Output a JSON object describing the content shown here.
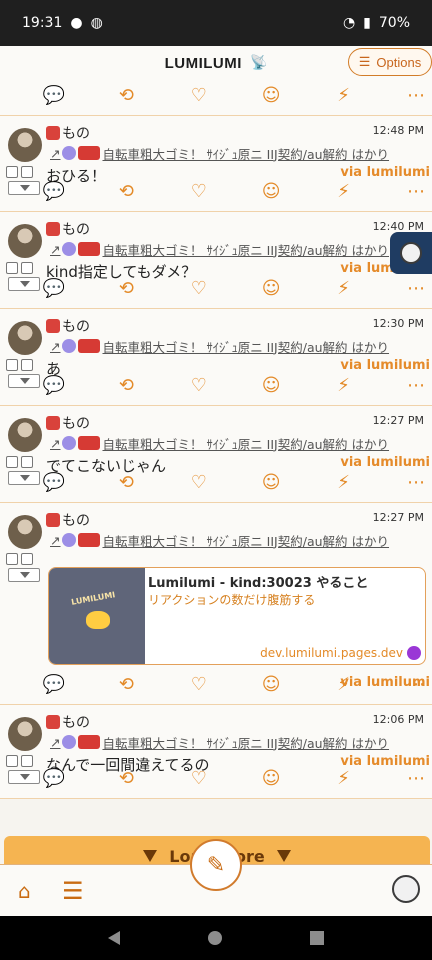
{
  "statusbar": {
    "time": "19:31",
    "battery": "70%"
  },
  "header": {
    "brand": "LUMILUMI",
    "options_label": "Options"
  },
  "timeline": {
    "top_fragment": "...",
    "posts": [
      {
        "name": "もの",
        "time": "12:48 PM",
        "reply_text": "自転車粗大ゴミ！ ｻｲｼﾞｭ原ニ IIJ契約/au解約 はかり",
        "content": "おひる！",
        "via": "via lumilumi"
      },
      {
        "name": "もの",
        "time": "12:40 PM",
        "reply_text": "自転車粗大ゴミ！ ｻｲｼﾞｭ原ニ IIJ契約/au解約 はかり",
        "content": "kind指定してもダメ？",
        "via": "via lumilumi"
      },
      {
        "name": "もの",
        "time": "12:30 PM",
        "reply_text": "自転車粗大ゴミ！ ｻｲｼﾞｭ原ニ IIJ契約/au解約 はかり",
        "content": "あ",
        "via": "via lumilumi"
      },
      {
        "name": "もの",
        "time": "12:27 PM",
        "reply_text": "自転車粗大ゴミ！ ｻｲｼﾞｭ原ニ IIJ契約/au解約 はかり",
        "content": "でてこないじゃん",
        "via": "via lumilumi"
      },
      {
        "name": "もの",
        "time": "12:27 PM",
        "reply_text": "自転車粗大ゴミ！ ｻｲｼﾞｭ原ニ IIJ契約/au解約 はかり",
        "card": {
          "title": "Lumilumi - kind:30023 やること",
          "desc": "リアクションの数だけ腹筋する",
          "domain": "dev.lumilumi.pages.dev",
          "thumb_text": "LUMILUMI"
        },
        "via": "via lumilumi"
      },
      {
        "name": "もの",
        "time": "12:06 PM",
        "reply_text": "自転車粗大ゴミ！ ｻｲｼﾞｭ原ニ IIJ契約/au解約 はかり",
        "content": "なんで一回間違えてるの",
        "via": "via lumilumi"
      }
    ]
  },
  "loadmore": {
    "label": "Load more"
  },
  "icons": {
    "relay": "radio-tower-icon",
    "options": "sliders-icon",
    "reply": "chat-icon",
    "repost": "repost-icon",
    "like": "heart-icon",
    "emoji": "emoji-add-icon",
    "zap": "zap-icon",
    "more": "more-icon",
    "home": "home-icon",
    "menu": "menu-icon",
    "compose": "compose-icon"
  },
  "colors": {
    "accent": "#e38a28",
    "brand_dark": "#6a3909",
    "header_bg": "#fbfaf7",
    "timeline_bg": "#f6f4ef"
  }
}
